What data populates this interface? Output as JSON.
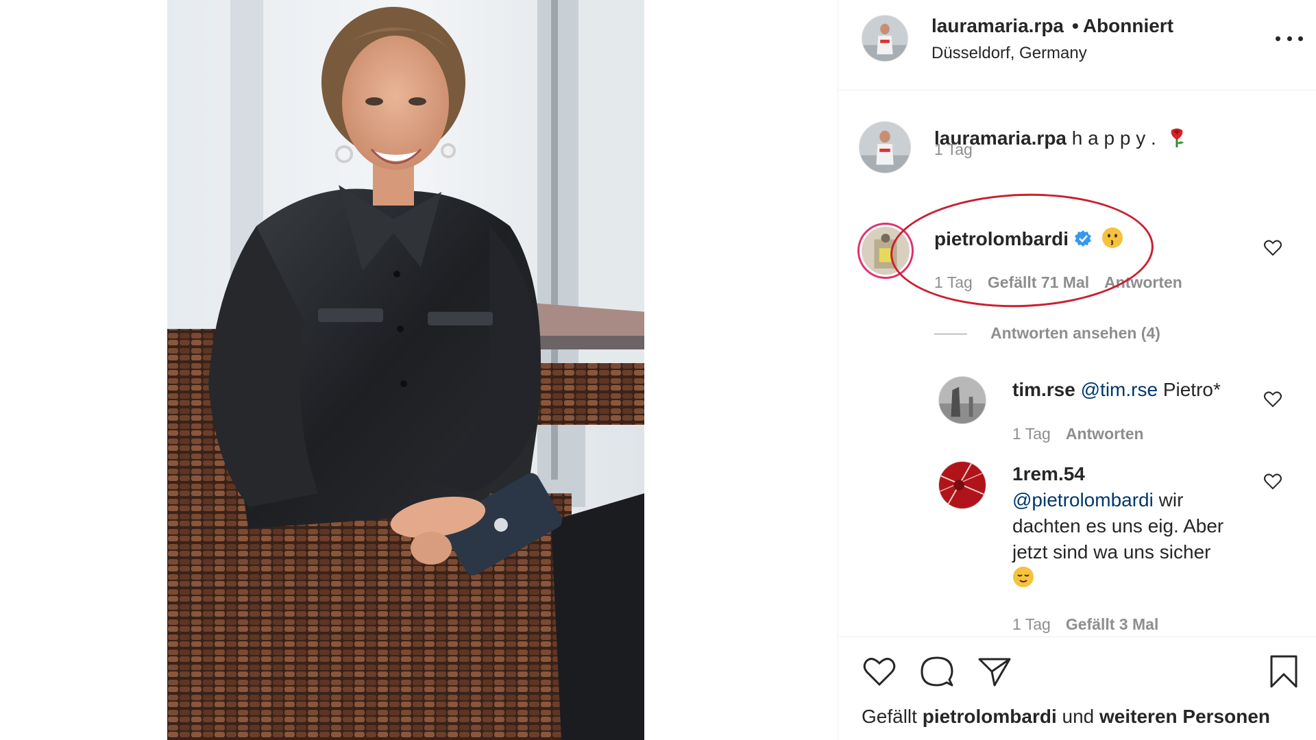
{
  "post": {
    "author": "lauramaria.rpa",
    "separator": "•",
    "follow_status": "Abonniert",
    "location": "Düsseldorf, Germany",
    "more_icon": "more-options-icon"
  },
  "caption": {
    "username": "lauramaria.rpa",
    "text": "h a p p y .",
    "emoji": "rose-emoji",
    "time": "1 Tag"
  },
  "comments": [
    {
      "username": "pietrolombardi",
      "verified": true,
      "emoji": "kissing-face-emoji",
      "time": "1 Tag",
      "likes": "Gefällt 71 Mal",
      "reply": "Antworten",
      "annotation_color": "#c8202f"
    }
  ],
  "view_replies": "Antworten ansehen (4)",
  "replies": [
    {
      "username": "tim.rse",
      "mention": "@tim.rse",
      "text": "Pietro*",
      "time": "1 Tag",
      "reply": "Antworten"
    },
    {
      "username": "1rem.54",
      "mention": "@pietrolombardi",
      "text_line1": "wir",
      "text_line2": "dachten es uns eig. Aber",
      "text_line3": "jetzt sind wa uns sicher",
      "emoji": "relieved-face-emoji",
      "time": "1 Tag",
      "likes": "Gefällt 3 Mal"
    }
  ],
  "action_bar": {
    "icons": [
      "heart-icon",
      "comment-icon",
      "share-icon",
      "bookmark-icon"
    ],
    "likes_prefix": "Gefällt",
    "likes_user": "pietrolombardi",
    "likes_and": "und",
    "likes_others": "weiteren Personen"
  },
  "colors": {
    "text": "#262626",
    "secondary": "#8e8e8e",
    "mention": "#00376b",
    "verified": "#3897f0",
    "annotation": "#c8202f"
  }
}
